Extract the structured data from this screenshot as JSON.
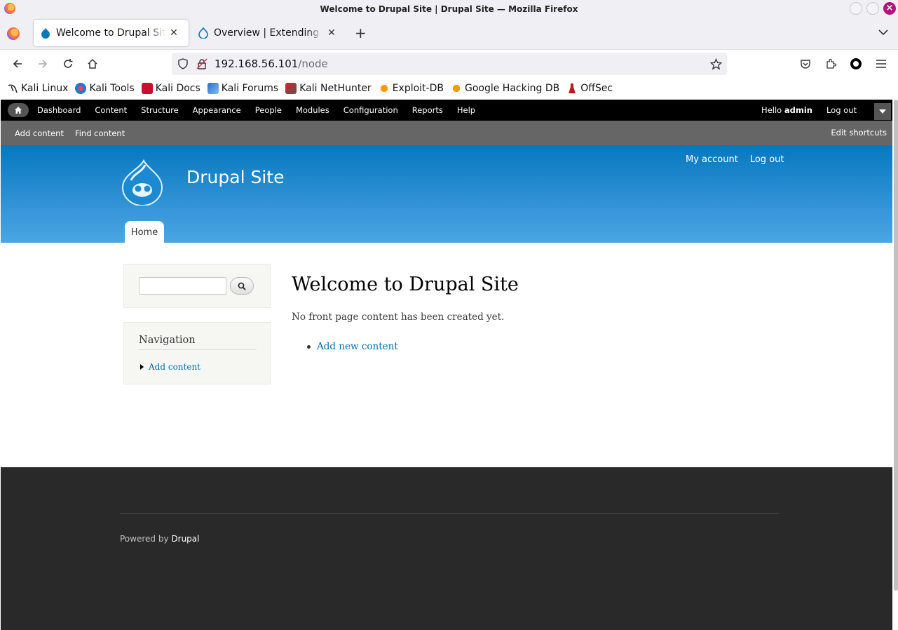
{
  "window": {
    "title": "Welcome to Drupal Site | Drupal Site — Mozilla Firefox"
  },
  "tabs": [
    {
      "label": "Welcome to Drupal Site | Drupal Site",
      "active": true
    },
    {
      "label": "Overview | Extending Drupal | Drupal Wiki",
      "active": false
    }
  ],
  "urlbar": {
    "host": "192.168.56.101",
    "path": "/node"
  },
  "bookmarks": [
    {
      "label": "Kali Linux",
      "icon": "kali-dragon-icon"
    },
    {
      "label": "Kali Tools",
      "icon": "kali-tools-icon"
    },
    {
      "label": "Kali Docs",
      "icon": "kali-docs-icon"
    },
    {
      "label": "Kali Forums",
      "icon": "kali-forums-icon"
    },
    {
      "label": "Kali NetHunter",
      "icon": "nethunter-icon"
    },
    {
      "label": "Exploit-DB",
      "icon": "exploit-db-icon"
    },
    {
      "label": "Google Hacking DB",
      "icon": "ghdb-icon"
    },
    {
      "label": "OffSec",
      "icon": "offsec-icon"
    }
  ],
  "admin_toolbar": {
    "menu": [
      "Dashboard",
      "Content",
      "Structure",
      "Appearance",
      "People",
      "Modules",
      "Configuration",
      "Reports",
      "Help"
    ],
    "hello": "Hello",
    "user": "admin",
    "logout": "Log out"
  },
  "shortcuts": {
    "items": [
      "Add content",
      "Find content"
    ],
    "edit": "Edit shortcuts"
  },
  "site": {
    "name": "Drupal Site",
    "user_menu": [
      "My account",
      "Log out"
    ],
    "main_tab": "Home"
  },
  "sidebar": {
    "nav_title": "Navigation",
    "nav_items": [
      "Add content"
    ]
  },
  "main": {
    "title": "Welcome to Drupal Site",
    "body": "No front page content has been created yet.",
    "action_link": "Add new content"
  },
  "footer": {
    "powered_prefix": "Powered by",
    "powered_link": "Drupal"
  },
  "colors": {
    "header_top": "#0778bf",
    "header_bottom": "#4ba6e4",
    "link": "#0071b3",
    "footer_bg": "#292929"
  }
}
